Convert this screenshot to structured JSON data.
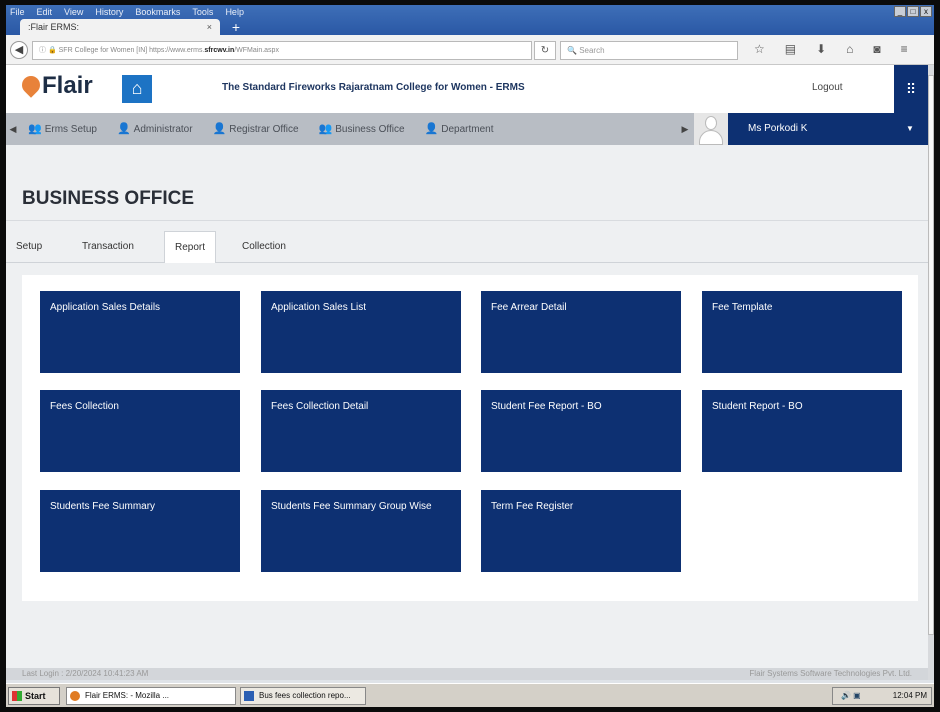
{
  "browser": {
    "menu": [
      "File",
      "Edit",
      "View",
      "History",
      "Bookmarks",
      "Tools",
      "Help"
    ],
    "window_controls": [
      "_",
      "□",
      "x"
    ],
    "tab_title": ":Flair ERMS:",
    "url_site": "SFR College for Women [IN]",
    "url_path": "https://www.erms.",
    "url_domain": "sfrcwv.in",
    "url_rest": "/WFMain.aspx",
    "search_placeholder": "Search"
  },
  "app": {
    "logo": "Flair",
    "college_title": "The Standard Fireworks Rajaratnam College for Women - ERMS",
    "logout": "Logout"
  },
  "modules": [
    {
      "label": "Erms Setup"
    },
    {
      "label": "Administrator"
    },
    {
      "label": "Registrar Office"
    },
    {
      "label": "Business Office"
    },
    {
      "label": "Department"
    }
  ],
  "user": {
    "name": "Ms Porkodi K"
  },
  "page": {
    "title": "BUSINESS OFFICE",
    "tabs": [
      {
        "label": "Setup"
      },
      {
        "label": "Transaction"
      },
      {
        "label": "Report"
      },
      {
        "label": "Collection"
      }
    ],
    "tiles": [
      "Application Sales Details",
      "Application Sales List",
      "Fee Arrear Detail",
      "Fee Template",
      "Fees Collection",
      "Fees Collection Detail",
      "Student Fee Report - BO",
      "Student Report - BO",
      "Students Fee Summary",
      "Students Fee Summary Group Wise",
      "Term Fee Register"
    ]
  },
  "footer": {
    "left": "Last Login : 2/20/2024 10:41:23 AM",
    "right": "Flair Systems Software Technologies Pvt. Ltd."
  },
  "taskbar": {
    "start": "Start",
    "item1": "Flair ERMS: - Mozilla ...",
    "item2": "Bus fees collection repo...",
    "clock": "12:04 PM"
  }
}
